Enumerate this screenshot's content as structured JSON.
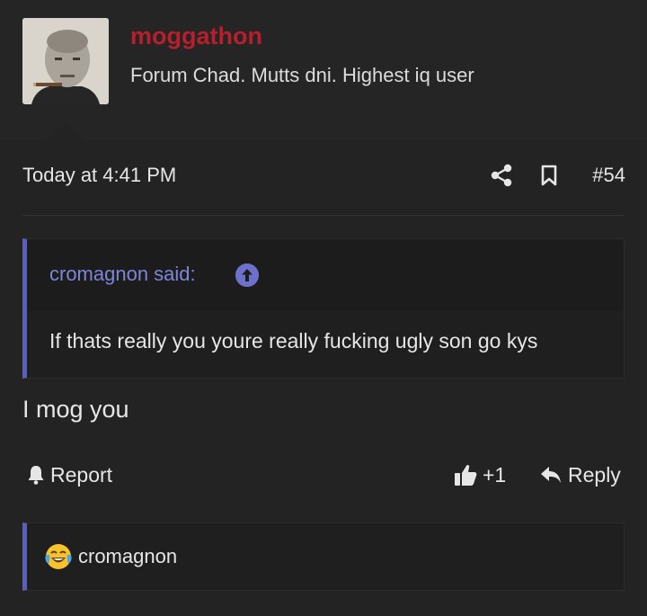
{
  "post": {
    "author": "moggathon",
    "user_title": "Forum Chad. Mutts dni. Highest iq user",
    "timestamp": "Today at 4:41 PM",
    "post_number": "#54",
    "message": "I mog you"
  },
  "quote": {
    "author_label": "cromagnon said:",
    "text": "If thats really you youre really fucking ugly son go kys"
  },
  "actions": {
    "report_label": "Report",
    "like_count": "+1",
    "reply_label": "Reply"
  },
  "reactions": {
    "emoji_icon": "crying-laughing-emoji",
    "user": "cromagnon"
  },
  "colors": {
    "background": "#232323",
    "username": "#b61f2b",
    "quote_accent": "#5a5fb8",
    "quote_author": "#7f85d8"
  }
}
